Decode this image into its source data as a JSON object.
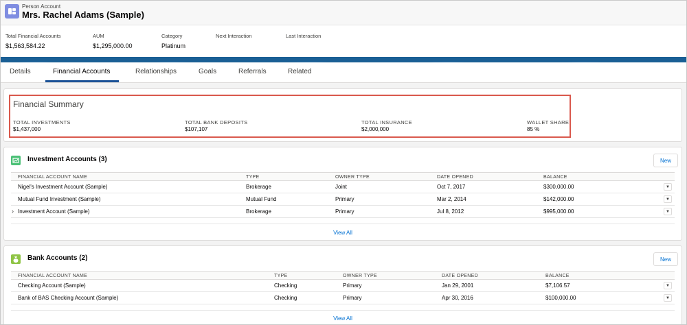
{
  "record": {
    "type": "Person Account",
    "name": "Mrs. Rachel Adams (Sample)"
  },
  "highlights": [
    {
      "label": "Total Financial Accounts",
      "value": "$1,563,584.22"
    },
    {
      "label": "AUM",
      "value": "$1,295,000.00"
    },
    {
      "label": "Category",
      "value": "Platinum"
    },
    {
      "label": "Next Interaction",
      "value": ""
    },
    {
      "label": "Last Interaction",
      "value": ""
    }
  ],
  "tabs": [
    "Details",
    "Financial Accounts",
    "Relationships",
    "Goals",
    "Referrals",
    "Related"
  ],
  "active_tab": "Financial Accounts",
  "summary": {
    "title": "Financial Summary",
    "items": [
      {
        "label": "TOTAL INVESTMENTS",
        "value": "$1,437,000"
      },
      {
        "label": "TOTAL BANK DEPOSITS",
        "value": "$107,107"
      },
      {
        "label": "TOTAL INSURANCE",
        "value": "$2,000,000"
      },
      {
        "label": "WALLET SHARE",
        "value": "85 %"
      }
    ]
  },
  "investment": {
    "title": "Investment Accounts (3)",
    "new_label": "New",
    "view_all": "View All",
    "columns": [
      "FINANCIAL ACCOUNT NAME",
      "TYPE",
      "OWNER TYPE",
      "DATE OPENED",
      "BALANCE"
    ],
    "rows": [
      {
        "name": "Nigel's Investment Account (Sample)",
        "type": "Brokerage",
        "owner": "Joint",
        "date": "Oct 7, 2017",
        "balance": "$300,000.00"
      },
      {
        "name": "Mutual Fund Investment (Sample)",
        "type": "Mutual Fund",
        "owner": "Primary",
        "date": "Mar 2, 2014",
        "balance": "$142,000.00"
      },
      {
        "name": "Investment Account (Sample)",
        "type": "Brokerage",
        "owner": "Primary",
        "date": "Jul 8, 2012",
        "balance": "$995,000.00"
      }
    ]
  },
  "bank": {
    "title": "Bank Accounts (2)",
    "new_label": "New",
    "view_all": "View All",
    "columns": [
      "FINANCIAL ACCOUNT NAME",
      "TYPE",
      "OWNER TYPE",
      "DATE OPENED",
      "BALANCE"
    ],
    "rows": [
      {
        "name": "Checking Account (Sample)",
        "type": "Checking",
        "owner": "Primary",
        "date": "Jan 29, 2001",
        "balance": "$7,106.57"
      },
      {
        "name": "Bank of BAS Checking Account (Sample)",
        "type": "Checking",
        "owner": "Primary",
        "date": "Apr 30, 2016",
        "balance": "$100,000.00"
      }
    ]
  },
  "colors": {
    "accent": "#0070d2",
    "record_icon": "#7f8de1",
    "investment_icon": "#4bc076",
    "bank_icon": "#8fc446",
    "highlight_border": "#d9584c",
    "stripe": "#1a5f95"
  },
  "icons": {
    "record": "person-account-icon",
    "investment": "investment-icon",
    "bank": "bank-icon",
    "row_menu": "chevron-down-icon",
    "expand": "chevron-right-icon"
  }
}
